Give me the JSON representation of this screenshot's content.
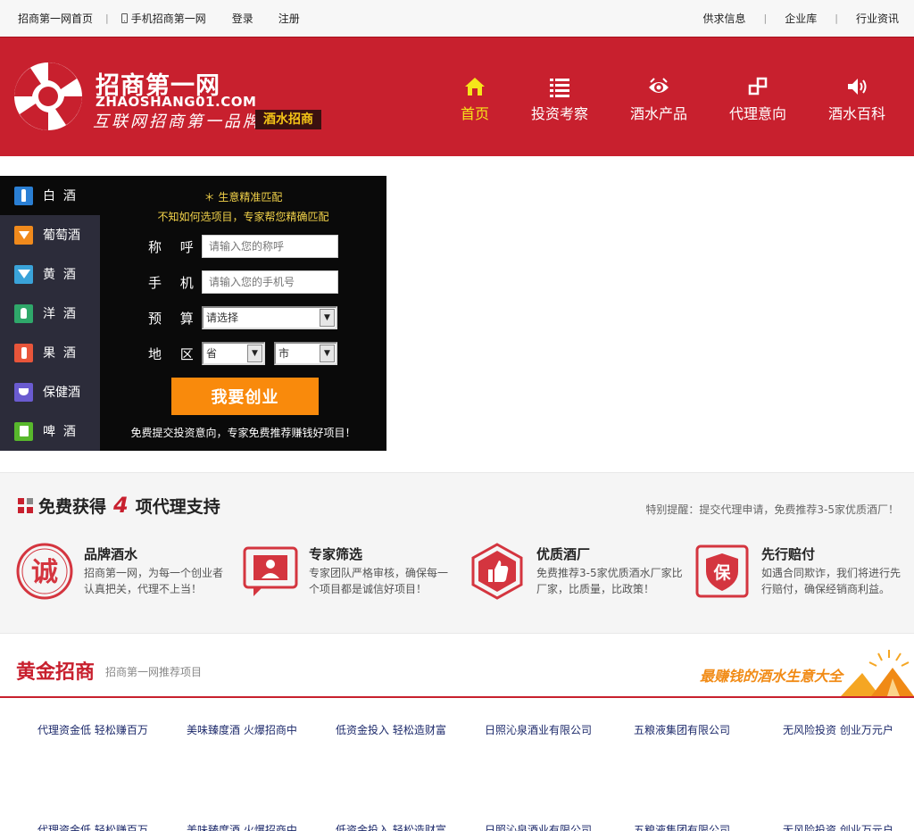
{
  "topbar": {
    "left": [
      "招商第一网首页",
      "手机招商第一网",
      "登录",
      "注册"
    ],
    "right": [
      "供求信息",
      "企业库",
      "行业资讯"
    ]
  },
  "brand": {
    "title": "招商第一网",
    "domain": "ZHAOSHANG01.COM",
    "slogan": "互联网招商第一品牌",
    "tag": "酒水招商"
  },
  "nav": [
    {
      "label": "首页",
      "icon": "home-icon",
      "active": true
    },
    {
      "label": "投资考察",
      "icon": "list-icon"
    },
    {
      "label": "酒水产品",
      "icon": "eye-icon"
    },
    {
      "label": "代理意向",
      "icon": "link-icon"
    },
    {
      "label": "酒水百科",
      "icon": "speaker-icon"
    }
  ],
  "categories": [
    {
      "label": "白  酒",
      "icon": "bottle-icon",
      "color": "#2a7fd4"
    },
    {
      "label": "葡萄酒",
      "icon": "wine-glass-icon",
      "color": "#f08a1c"
    },
    {
      "label": "黄  酒",
      "icon": "cocktail-icon",
      "color": "#3aa3d9"
    },
    {
      "label": "洋  酒",
      "icon": "liquor-icon",
      "color": "#2fa86a"
    },
    {
      "label": "果  酒",
      "icon": "fruit-wine-icon",
      "color": "#e8553a"
    },
    {
      "label": "保健酒",
      "icon": "health-wine-icon",
      "color": "#6a5bd0"
    },
    {
      "label": "啤  酒",
      "icon": "beer-icon",
      "color": "#58b82c"
    }
  ],
  "form": {
    "hint1": "＊ 生意精准匹配",
    "hint2": "不知如何选项目，专家帮您精确匹配",
    "name_label": "称 呼",
    "name_placeholder": "请输入您的称呼",
    "phone_label": "手 机",
    "phone_placeholder": "请输入您的手机号",
    "budget_label": "预 算",
    "budget_value": "请选择",
    "region_label": "地 区",
    "province_value": "省",
    "city_value": "市",
    "submit": "我要创业",
    "foot": "免费提交投资意向，专家免费推荐赚钱好项目！"
  },
  "support": {
    "title_pre": "免费获得",
    "title_num": "4",
    "title_post": "项代理支持",
    "note": "特别提醒：提交代理申请，免费推荐3-5家优质酒厂！",
    "items": [
      {
        "title": "品牌酒水",
        "desc": "招商第一网，为每一个创业者认真把关，代理不上当！",
        "icon": "cheng-icon",
        "badge": "诚"
      },
      {
        "title": "专家筛选",
        "desc": "专家团队严格审核，确保每一个项目都是诚信好项目！",
        "icon": "expert-icon"
      },
      {
        "title": "优质酒厂",
        "desc": "免费推荐3-5家优质酒水厂家比厂家，比质量，比政策！",
        "icon": "thumbs-up-icon"
      },
      {
        "title": "先行赔付",
        "desc": "如遇合同欺诈，我们将进行先行赔付，确保经销商利益。",
        "icon": "bao-icon",
        "badge": "保"
      }
    ]
  },
  "gold": {
    "title": "黄金招商",
    "subtitle": "招商第一网推荐项目",
    "slogan": "最赚钱的酒水生意大全",
    "projects": [
      "代理资金低 轻松赚百万",
      "美味臻度酒 火爆招商中",
      "低资金投入 轻松造财富",
      "日照沁泉酒业有限公司",
      "五粮液集团有限公司",
      "无风险投资 创业万元户"
    ],
    "projects_row2": [
      "代理资金低 轻松赚百万",
      "美味臻度酒 火爆招商中",
      "低资金投入 轻松造财富",
      "日照沁泉酒业有限公司",
      "五粮液集团有限公司",
      "无风险投资 创业万元户"
    ]
  },
  "colors": {
    "brand_red": "#c8202e",
    "accent_yellow": "#f5e51a",
    "cta_orange": "#f98a0c"
  }
}
